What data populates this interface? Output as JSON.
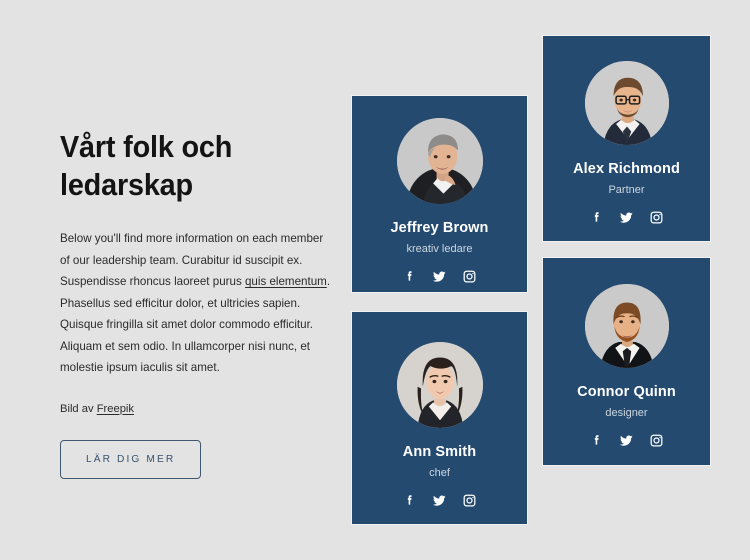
{
  "page": {
    "background_color": "#e4e3e3",
    "card_color": "#244a70"
  },
  "intro": {
    "headline": "Vårt folk och\nledarskap",
    "body_before_link": "Below you'll find more information on each member of our leadership team. Curabitur id suscipit ex. Suspendisse rhoncus laoreet purus ",
    "body_link": "quis elementum",
    "body_after_link": ". Phasellus sed efficitur dolor, et ultricies sapien. Quisque fringilla sit amet dolor commodo efficitur. Aliquam et sem odio. In ullamcorper nisi nunc, et molestie ipsum iaculis sit amet.",
    "credit_prefix": "Bild av ",
    "credit_link": "Freepik",
    "cta_label": "LÄR DIG MER"
  },
  "social_icons": [
    {
      "name": "facebook-icon",
      "label": "Facebook"
    },
    {
      "name": "twitter-icon",
      "label": "Twitter"
    },
    {
      "name": "instagram-icon",
      "label": "Instagram"
    }
  ],
  "team": [
    {
      "name": "Jeffrey Brown",
      "role": "kreativ ledare",
      "avatar": "portrait-man-grey-hair"
    },
    {
      "name": "Ann Smith",
      "role": "chef",
      "avatar": "portrait-woman-dark-hair"
    },
    {
      "name": "Alex Richmond",
      "role": "Partner",
      "avatar": "portrait-man-glasses"
    },
    {
      "name": "Connor Quinn",
      "role": "designer",
      "avatar": "portrait-man-beard"
    }
  ]
}
